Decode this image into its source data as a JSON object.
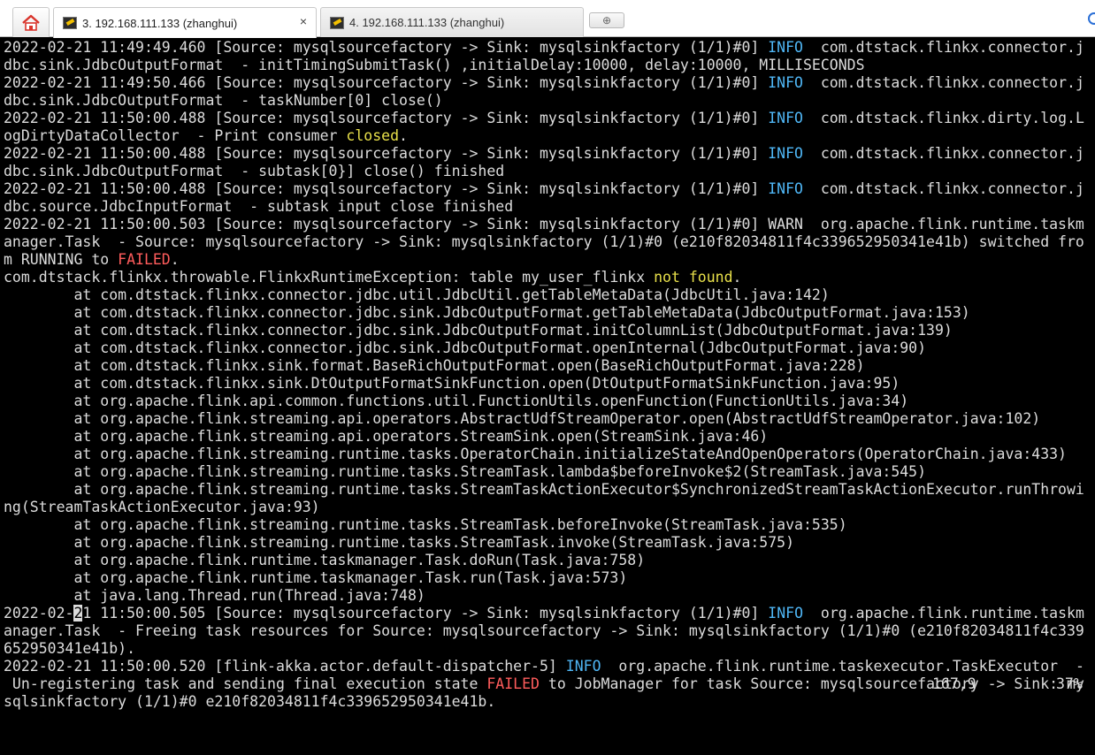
{
  "tabs": [
    {
      "label": "3. 192.168.111.133 (zhanghui)",
      "close": "×",
      "active": true
    },
    {
      "label": "4. 192.168.111.133 (zhanghui)",
      "active": false
    }
  ],
  "new_tab_glyph": "⊕",
  "colors": {
    "info": "#4fb6f5",
    "failed": "#ff5c5c",
    "highlight": "#e8e04a"
  },
  "terminal_lines": [
    [
      {
        "t": "2022-02-21 11:49:49.460 [Source: mysqlsourcefactory -> Sink: mysqlsinkfactory (1/1)#0] "
      },
      {
        "t": "INFO",
        "c": "info"
      },
      {
        "t": "  com.dtstack.flinkx.connector.j"
      }
    ],
    [
      {
        "t": "dbc.sink.JdbcOutputFormat  - initTimingSubmitTask() ,initialDelay:10000, delay:10000, MILLISECONDS"
      }
    ],
    [
      {
        "t": "2022-02-21 11:49:50.466 [Source: mysqlsourcefactory -> Sink: mysqlsinkfactory (1/1)#0] "
      },
      {
        "t": "INFO",
        "c": "info"
      },
      {
        "t": "  com.dtstack.flinkx.connector.j"
      }
    ],
    [
      {
        "t": "dbc.sink.JdbcOutputFormat  - taskNumber[0] close()"
      }
    ],
    [
      {
        "t": "2022-02-21 11:50:00.488 [Source: mysqlsourcefactory -> Sink: mysqlsinkfactory (1/1)#0] "
      },
      {
        "t": "INFO",
        "c": "info"
      },
      {
        "t": "  com.dtstack.flinkx.dirty.log.L"
      }
    ],
    [
      {
        "t": "ogDirtyDataCollector  - Print consumer "
      },
      {
        "t": "closed",
        "c": "yellow"
      },
      {
        "t": "."
      }
    ],
    [
      {
        "t": "2022-02-21 11:50:00.488 [Source: mysqlsourcefactory -> Sink: mysqlsinkfactory (1/1)#0] "
      },
      {
        "t": "INFO",
        "c": "info"
      },
      {
        "t": "  com.dtstack.flinkx.connector.j"
      }
    ],
    [
      {
        "t": "dbc.sink.JdbcOutputFormat  - subtask[0}] close() finished"
      }
    ],
    [
      {
        "t": "2022-02-21 11:50:00.488 [Source: mysqlsourcefactory -> Sink: mysqlsinkfactory (1/1)#0] "
      },
      {
        "t": "INFO",
        "c": "info"
      },
      {
        "t": "  com.dtstack.flinkx.connector.j"
      }
    ],
    [
      {
        "t": "dbc.source.JdbcInputFormat  - subtask input close finished"
      }
    ],
    [
      {
        "t": "2022-02-21 11:50:00.503 [Source: mysqlsourcefactory -> Sink: mysqlsinkfactory (1/1)#0] WARN  org.apache.flink.runtime.taskm"
      }
    ],
    [
      {
        "t": "anager.Task  - Source: mysqlsourcefactory -> Sink: mysqlsinkfactory (1/1)#0 (e210f82034811f4c339652950341e41b) switched fro"
      }
    ],
    [
      {
        "t": "m RUNNING to "
      },
      {
        "t": "FAILED",
        "c": "fail"
      },
      {
        "t": "."
      }
    ],
    [
      {
        "t": "com.dtstack.flinkx.throwable.FlinkxRuntimeException: table my_user_flinkx "
      },
      {
        "t": "not found",
        "c": "yellow"
      },
      {
        "t": "."
      }
    ],
    [
      {
        "t": "        at com.dtstack.flinkx.connector.jdbc.util.JdbcUtil.getTableMetaData(JdbcUtil.java:142)"
      }
    ],
    [
      {
        "t": "        at com.dtstack.flinkx.connector.jdbc.sink.JdbcOutputFormat.getTableMetaData(JdbcOutputFormat.java:153)"
      }
    ],
    [
      {
        "t": "        at com.dtstack.flinkx.connector.jdbc.sink.JdbcOutputFormat.initColumnList(JdbcOutputFormat.java:139)"
      }
    ],
    [
      {
        "t": "        at com.dtstack.flinkx.connector.jdbc.sink.JdbcOutputFormat.openInternal(JdbcOutputFormat.java:90)"
      }
    ],
    [
      {
        "t": "        at com.dtstack.flinkx.sink.format.BaseRichOutputFormat.open(BaseRichOutputFormat.java:228)"
      }
    ],
    [
      {
        "t": "        at com.dtstack.flinkx.sink.DtOutputFormatSinkFunction.open(DtOutputFormatSinkFunction.java:95)"
      }
    ],
    [
      {
        "t": "        at org.apache.flink.api.common.functions.util.FunctionUtils.openFunction(FunctionUtils.java:34)"
      }
    ],
    [
      {
        "t": "        at org.apache.flink.streaming.api.operators.AbstractUdfStreamOperator.open(AbstractUdfStreamOperator.java:102)"
      }
    ],
    [
      {
        "t": "        at org.apache.flink.streaming.api.operators.StreamSink.open(StreamSink.java:46)"
      }
    ],
    [
      {
        "t": "        at org.apache.flink.streaming.runtime.tasks.OperatorChain.initializeStateAndOpenOperators(OperatorChain.java:433)"
      }
    ],
    [
      {
        "t": "        at org.apache.flink.streaming.runtime.tasks.StreamTask.lambda$beforeInvoke$2(StreamTask.java:545)"
      }
    ],
    [
      {
        "t": "        at org.apache.flink.streaming.runtime.tasks.StreamTaskActionExecutor$SynchronizedStreamTaskActionExecutor.runThrowi"
      }
    ],
    [
      {
        "t": "ng(StreamTaskActionExecutor.java:93)"
      }
    ],
    [
      {
        "t": "        at org.apache.flink.streaming.runtime.tasks.StreamTask.beforeInvoke(StreamTask.java:535)"
      }
    ],
    [
      {
        "t": "        at org.apache.flink.streaming.runtime.tasks.StreamTask.invoke(StreamTask.java:575)"
      }
    ],
    [
      {
        "t": "        at org.apache.flink.runtime.taskmanager.Task.doRun(Task.java:758)"
      }
    ],
    [
      {
        "t": "        at org.apache.flink.runtime.taskmanager.Task.run(Task.java:573)"
      }
    ],
    [
      {
        "t": "        at java.lang.Thread.run(Thread.java:748)"
      }
    ],
    [
      {
        "t": "2022-02-"
      },
      {
        "t": "2",
        "c": "cursor"
      },
      {
        "t": "1 11:50:00.505 [Source: mysqlsourcefactory -> Sink: mysqlsinkfactory (1/1)#0] "
      },
      {
        "t": "INFO",
        "c": "info"
      },
      {
        "t": "  org.apache.flink.runtime.taskm"
      }
    ],
    [
      {
        "t": "anager.Task  - Freeing task resources for Source: mysqlsourcefactory -> Sink: mysqlsinkfactory (1/1)#0 (e210f82034811f4c339"
      }
    ],
    [
      {
        "t": "652950341e41b)."
      }
    ],
    [
      {
        "t": "2022-02-21 11:50:00.520 [flink-akka.actor.default-dispatcher-5] "
      },
      {
        "t": "INFO",
        "c": "info"
      },
      {
        "t": "  org.apache.flink.runtime.taskexecutor.TaskExecutor  -"
      }
    ],
    [
      {
        "t": " Un-registering task and sending final execution state "
      },
      {
        "t": "FAILED",
        "c": "fail"
      },
      {
        "t": " to JobManager for task Source: mysqlsourcefactory -> Sink: my"
      }
    ],
    [
      {
        "t": "sqlsinkfactory (1/1)#0 e210f82034811f4c339652950341e41b."
      }
    ]
  ],
  "status": {
    "position": "167,9",
    "percent": "37%"
  }
}
